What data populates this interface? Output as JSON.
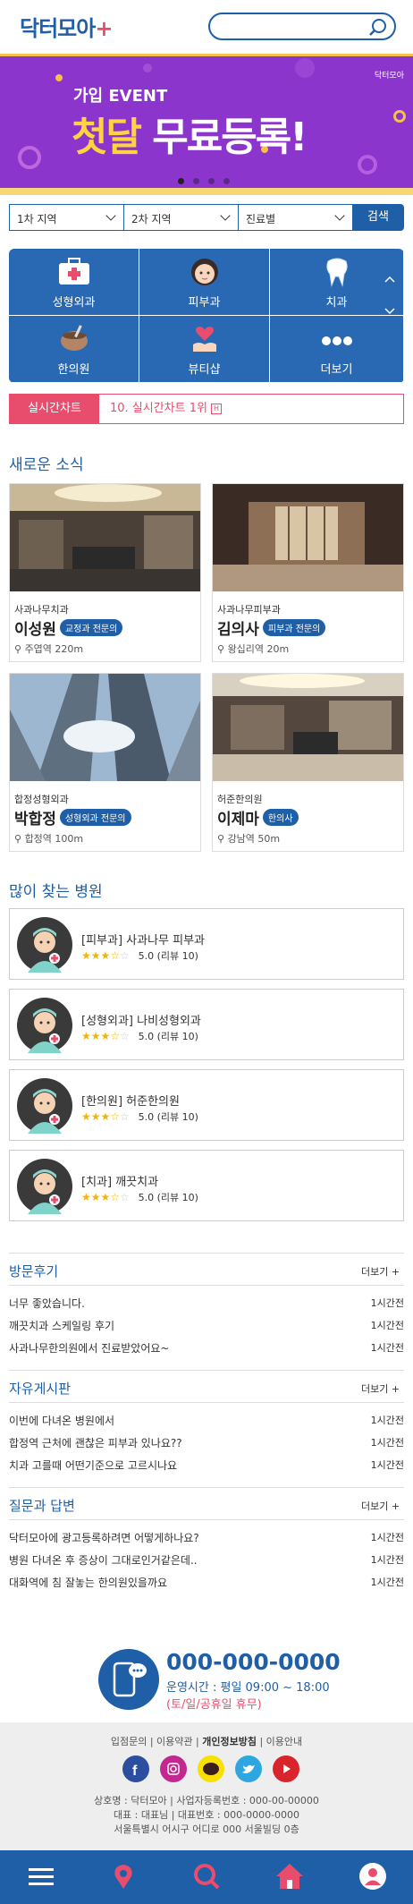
{
  "header": {
    "logo": "닥터모아",
    "search_placeholder": ""
  },
  "banner": {
    "tag": "닥터모아",
    "subtitle": "가입 EVENT",
    "title_highlight": "첫달",
    "title_rest": "무료등록!"
  },
  "filters": {
    "region1": "1차 지역",
    "region2": "2차 지역",
    "department": "진료별",
    "search_button": "검색"
  },
  "categories": [
    {
      "label": "성형외과",
      "icon": "first-aid-kit-icon"
    },
    {
      "label": "피부과",
      "icon": "woman-face-icon"
    },
    {
      "label": "치과",
      "icon": "tooth-icon"
    },
    {
      "label": "한의원",
      "icon": "herbal-bowl-icon"
    },
    {
      "label": "뷰티샵",
      "icon": "heart-hand-icon"
    },
    {
      "label": "더보기",
      "icon": "more-dots-icon"
    }
  ],
  "realtime": {
    "label": "실시간차트",
    "text": "10. 실시간차트 1위",
    "badge": "H"
  },
  "news": {
    "title": "새로운 소식",
    "cards": [
      {
        "hospital": "사과나무치과",
        "name": "이성원",
        "badge": "교정과 전문의",
        "location": "주엽역 220m"
      },
      {
        "hospital": "사과나무피부과",
        "name": "김의사",
        "badge": "피부과 전문의",
        "location": "왕십리역 20m"
      },
      {
        "hospital": "합정성형외과",
        "name": "박합정",
        "badge": "성형외과 전문의",
        "location": "합정역 100m"
      },
      {
        "hospital": "허준한의원",
        "name": "이제마",
        "badge": "한의사",
        "location": "강남역 50m"
      }
    ]
  },
  "popular": {
    "title": "많이 찾는 병원",
    "items": [
      {
        "name": "[피부과] 사과나무 피부과",
        "rating": "5.0",
        "reviews": "(리뷰 10)",
        "stars": 3.5
      },
      {
        "name": "[성형외과] 나비성형외과",
        "rating": "5.0",
        "reviews": "(리뷰 10)",
        "stars": 3.5
      },
      {
        "name": "[한의원] 허준한의원",
        "rating": "5.0",
        "reviews": "(리뷰 10)",
        "stars": 3.5
      },
      {
        "name": "[치과] 깨끗치과",
        "rating": "5.0",
        "reviews": "(리뷰 10)",
        "stars": 3.5
      }
    ]
  },
  "boards": [
    {
      "title": "방문후기",
      "more": "더보기 +",
      "rows": [
        {
          "text": "너무 좋았습니다.",
          "time": "1시간전"
        },
        {
          "text": "깨끗치과 스케일링 후기",
          "time": "1시간전"
        },
        {
          "text": "사과나무한의원에서 진료받았어요~",
          "time": "1시간전"
        }
      ]
    },
    {
      "title": "자유게시판",
      "more": "더보기 +",
      "rows": [
        {
          "text": "이번에 다녀온 병원에서",
          "time": "1시간전"
        },
        {
          "text": "합정역 근처에 괜찮은 피부과 있나요??",
          "time": "1시간전"
        },
        {
          "text": "치과 고를때 어떤기준으로 고르시나요",
          "time": "1시간전"
        }
      ]
    },
    {
      "title": "질문과 답변",
      "more": "더보기 +",
      "rows": [
        {
          "text": "닥터모아에 광고등록하려면 어떻게하나요?",
          "time": "1시간전"
        },
        {
          "text": "병원 다녀온 후 증상이 그대로인거같은데..",
          "time": "1시간전"
        },
        {
          "text": "대화역에 침 잘놓는 한의원있을까요",
          "time": "1시간전"
        }
      ]
    }
  ],
  "contact": {
    "phone": "000-000-0000",
    "hours": "운영시간 : 평일 09:00 ~ 18:00",
    "holiday": "(토/일/공휴일 휴무)"
  },
  "footer": {
    "link1": "입점문의",
    "link2": "이용약관",
    "link3": "개인정보방침",
    "link4": "이용안내",
    "sep": " | ",
    "line1": "상호명 : 닥터모아  |  사업자등록번호 : 000-00-00000",
    "line2": "대표 : 대표님  |  대표번호 : 000-0000-0000",
    "line3": "서울특별시 어시구 어디로 000 서울빌딩 0층"
  },
  "colors": {
    "primary": "#1f5fa8",
    "accent": "#e94d6d",
    "banner": "#8b35cc"
  }
}
